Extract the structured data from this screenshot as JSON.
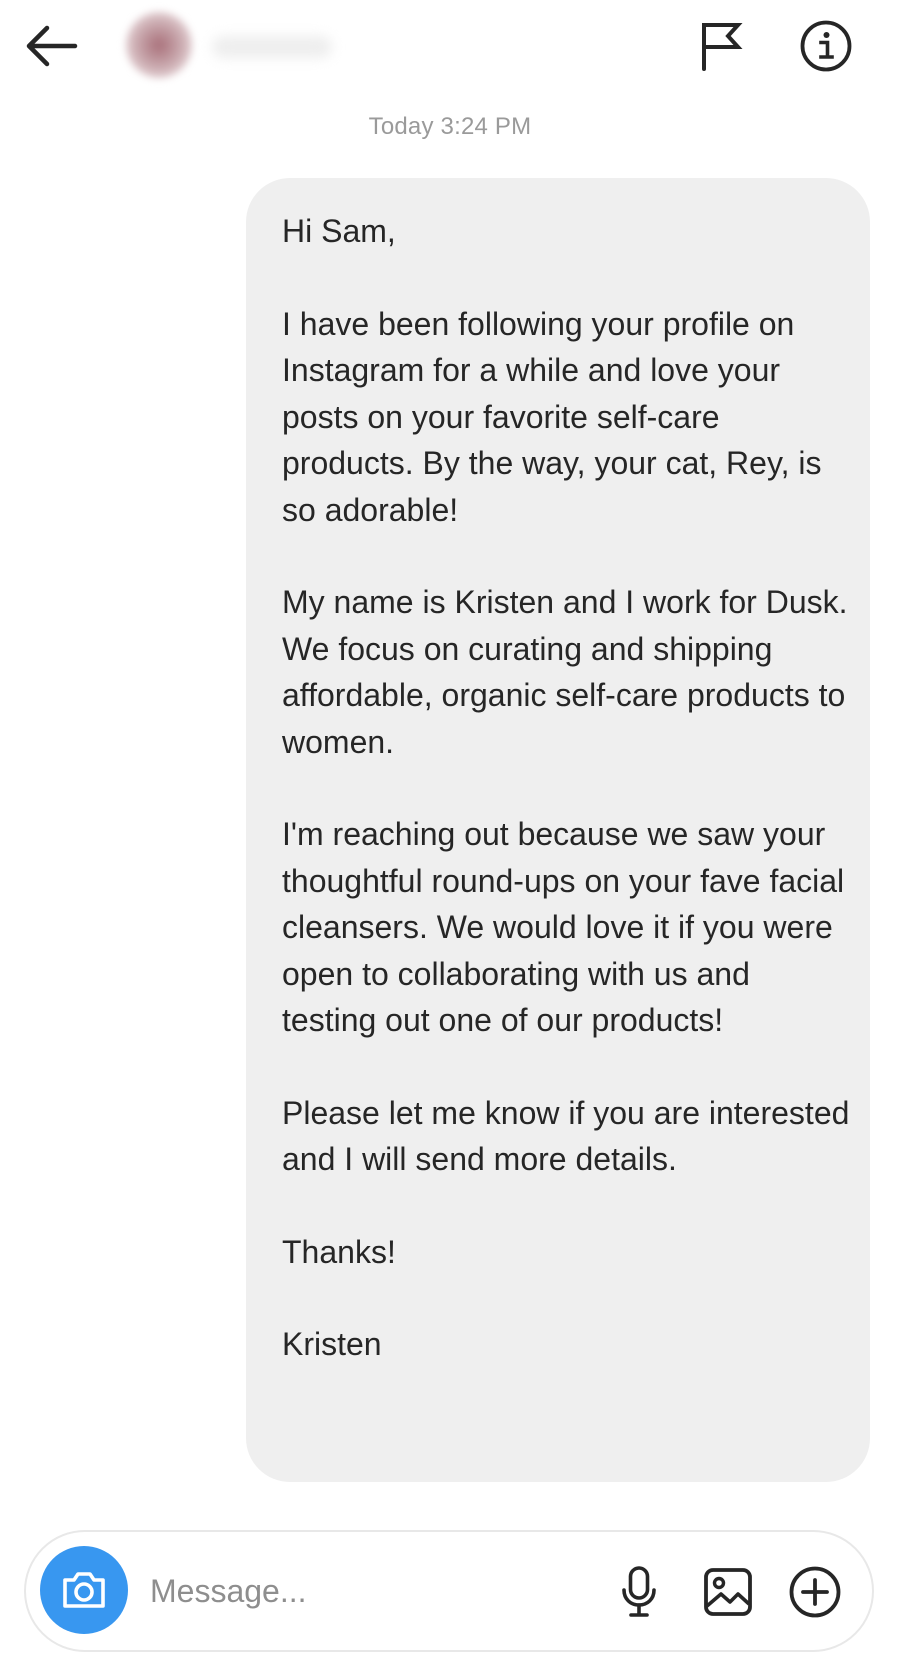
{
  "header": {
    "back_icon": "arrow-left-icon",
    "flag_icon": "flag-icon",
    "info_icon": "info-icon"
  },
  "conversation": {
    "timestamp": "Today 3:24 PM",
    "message": {
      "paragraphs": [
        "Hi Sam,",
        "I have been following your profile on Instagram for a while and love your posts on your favorite self-care products. By the way, your cat, Rey, is so adorable!",
        "My name is Kristen and I work for Dusk. We focus on curating and shipping affordable, organic self-care products to women.",
        "I'm reaching out because we saw your thoughtful round-ups on your fave facial cleansers. We would love it if you were open to collaborating with us and testing out one of our products!",
        "Please let me know if you are interested and I will send more details.",
        "Thanks!",
        "Kristen"
      ]
    }
  },
  "composer": {
    "placeholder": "Message...",
    "camera_icon": "camera-icon",
    "mic_icon": "microphone-icon",
    "gallery_icon": "image-gallery-icon",
    "add_icon": "plus-circle-icon"
  },
  "colors": {
    "camera_button": "#3897f0",
    "bubble": "#efefef",
    "timestamp": "#9a9a9a"
  }
}
